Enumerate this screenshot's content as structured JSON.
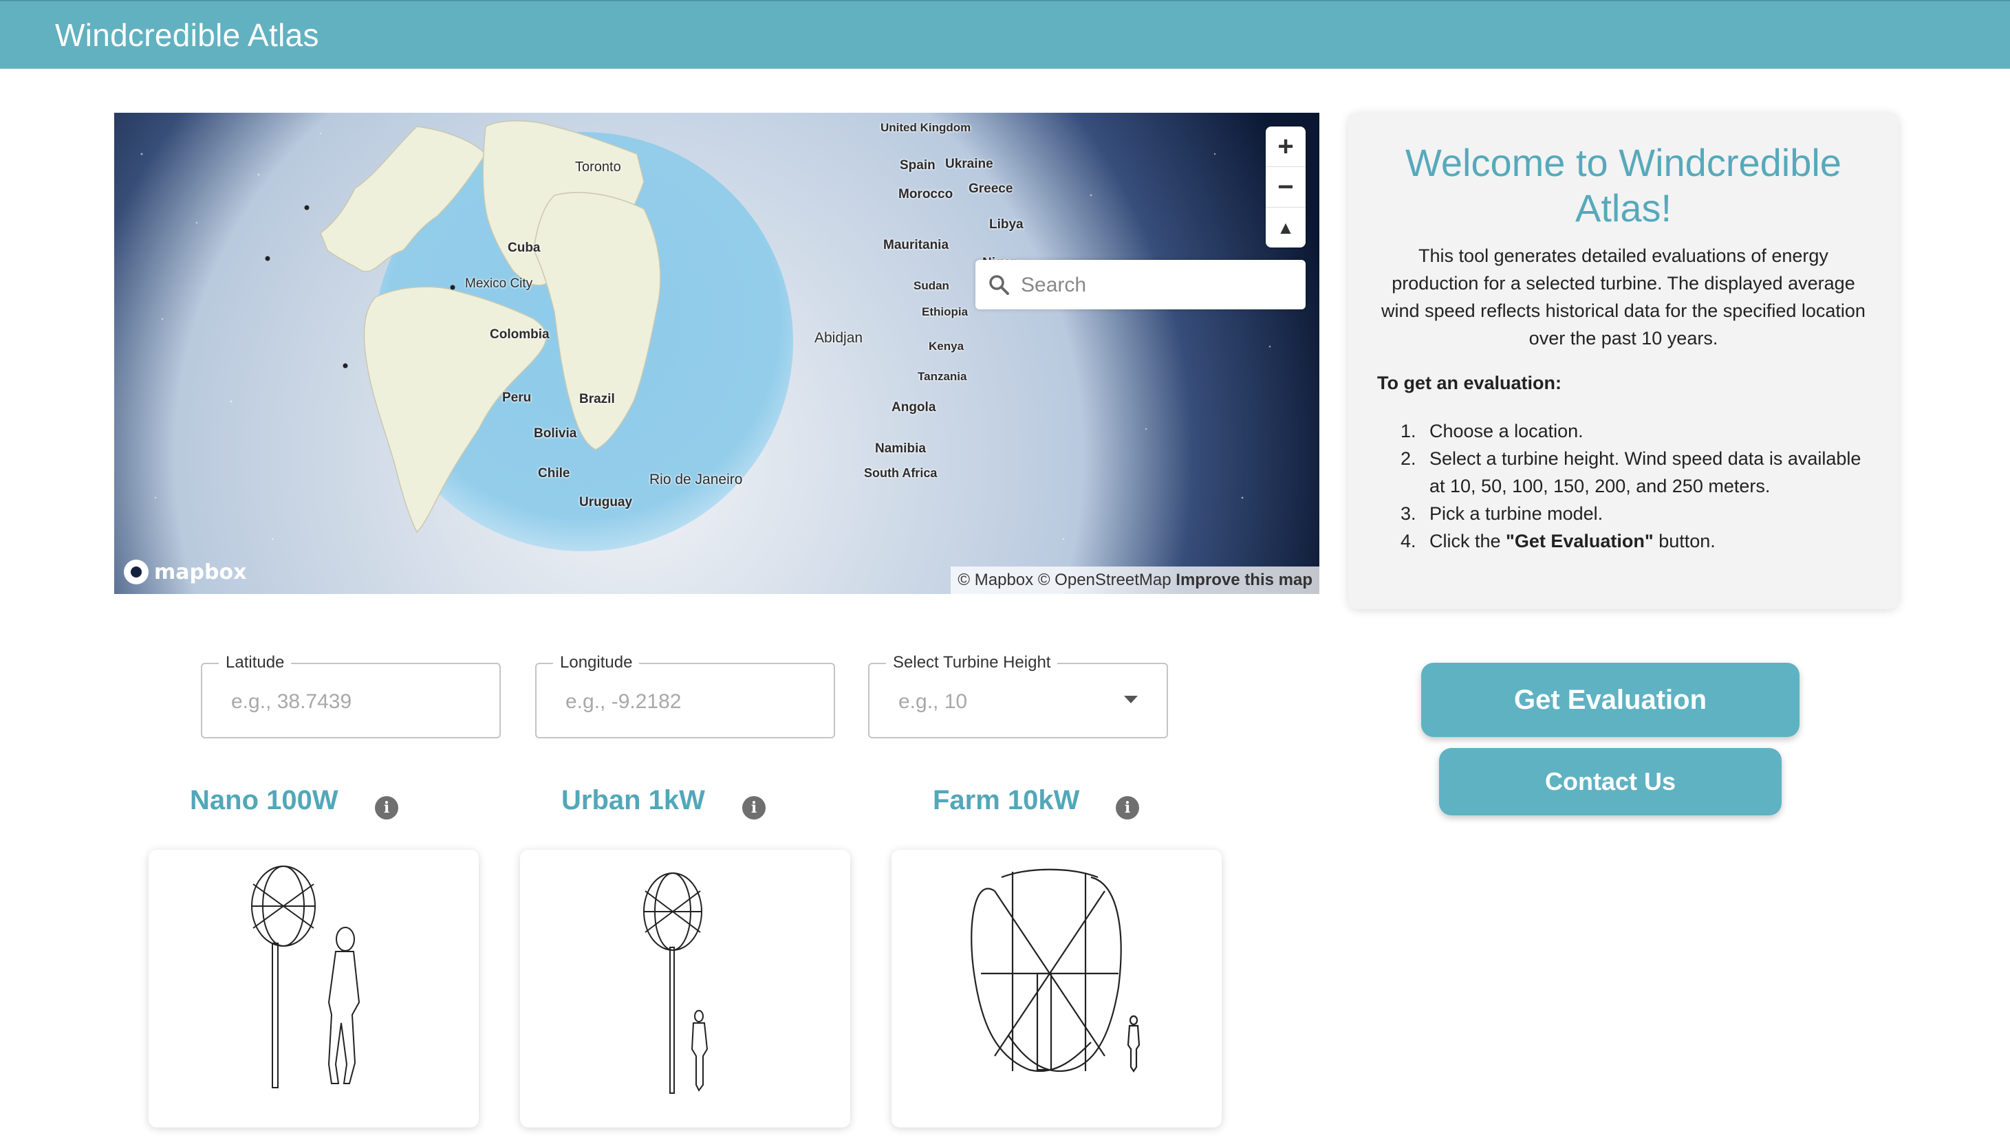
{
  "app": {
    "title": "Windcredible Atlas"
  },
  "map": {
    "search_placeholder": "Search",
    "zoom_in": "+",
    "zoom_out": "−",
    "compass": "▲",
    "logo": "mapbox",
    "attribution": "© Mapbox © OpenStreetMap",
    "improve_link": "Improve this map",
    "labels": {
      "united_kingdom": "United Kingdom",
      "spain": "Spain",
      "ukraine": "Ukraine",
      "morocco": "Morocco",
      "greece": "Greece",
      "toronto": "Toronto",
      "libya": "Libya",
      "mauritania": "Mauritania",
      "niger": "Niger",
      "cuba": "Cuba",
      "mexico_city": "Mexico City",
      "sudan": "Sudan",
      "ethiopia": "Ethiopia",
      "colombia": "Colombia",
      "abidjan": "Abidjan",
      "kenya": "Kenya",
      "tanzania": "Tanzania",
      "peru": "Peru",
      "brazil": "Brazil",
      "angola": "Angola",
      "bolivia": "Bolivia",
      "namibia": "Namibia",
      "chile": "Chile",
      "rio": "Rio de Janeiro",
      "south_africa": "South Africa",
      "uruguay": "Uruguay"
    },
    "colors": {
      "ocean": "#8ecbea",
      "land": "#eef0dc",
      "space": "#0e1e3f"
    }
  },
  "welcome": {
    "heading": "Welcome to Windcredible Atlas!",
    "intro": "This tool generates detailed evaluations of energy production for a selected turbine. The displayed average wind speed reflects historical data for the specified location over the past 10 years.",
    "howto": "To get an evaluation:",
    "steps": {
      "s1": "Choose a location.",
      "s2": "Select a turbine height. Wind speed data is available at 10, 50, 100, 150, 200, and 250 meters.",
      "s3": "Pick a turbine model.",
      "s4_pre": "Click the ",
      "s4_bold": "\"Get Evaluation\"",
      "s4_post": " button."
    }
  },
  "form": {
    "latitude": {
      "label": "Latitude",
      "placeholder": "e.g., 38.7439"
    },
    "longitude": {
      "label": "Longitude",
      "placeholder": "e.g., -9.2182"
    },
    "height": {
      "label": "Select Turbine Height",
      "placeholder": "e.g., 10"
    }
  },
  "buttons": {
    "evaluate": "Get Evaluation",
    "contact": "Contact Us"
  },
  "turbines": [
    {
      "name": "Nano 100W",
      "info": "i"
    },
    {
      "name": "Urban 1kW",
      "info": "i"
    },
    {
      "name": "Farm 10kW",
      "info": "i"
    }
  ],
  "theme": {
    "accent": "#5fb2c2",
    "heading_color": "#56a9bb"
  }
}
